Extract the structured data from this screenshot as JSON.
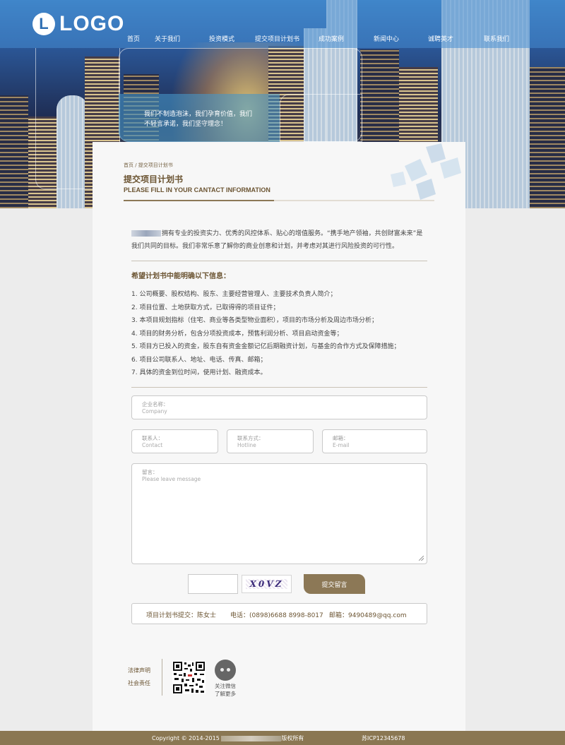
{
  "header": {
    "logo_letter": "L",
    "logo_text": "LOGO",
    "nav": [
      {
        "label": "首页"
      },
      {
        "label": "关于我们"
      },
      {
        "label": "投资模式"
      },
      {
        "label": "提交项目计划书"
      },
      {
        "label": "成功案例"
      },
      {
        "label": "新闻中心"
      },
      {
        "label": "诚聘英才"
      },
      {
        "label": "联系我们"
      }
    ]
  },
  "banner": {
    "slogan_line1": "我们不制造泡沫，我们孕育价值，我们",
    "slogan_line2": "不轻言承诺，我们坚守理念！"
  },
  "page": {
    "breadcrumb": "首页 / 提交项目计划书",
    "title": "提交项目计划书",
    "subtitle": "PLEASE FILL IN YOUR CANTACT INFORMATION",
    "intro": "拥有专业的投资实力、优秀的风控体系、贴心的增值服务。“携手地产领袖，共创财富未来”是我们共同的目标。我们非常乐意了解你的商业创意和计划，并考虑对其进行风险投资的可行性。",
    "list_title": "希望计划书中能明确以下信息：",
    "requirements": [
      "1. 公司概要、股权结构、股东、主要经营管理人、主要技术负责人简介；",
      "2. 项目位置、土地获取方式，已取得得的项目证件；",
      "3. 本项目规划指标（住宅、商业等各类型物业面积），项目的市场分析及周边市场分析；",
      "4. 项目的财务分析，包含分项投资成本，预售利润分析、项目启动资金等；",
      "5. 项目方已投入的资金，股东自有资金金额记亿后期融资计划，与基金的合作方式及保障措施；",
      "6. 项目公司联系人、地址、电话、传真、邮箱；",
      "7. 具体的资金到位时间，使用计划、融资成本。"
    ]
  },
  "form": {
    "company": {
      "label": "企业名称：",
      "placeholder": "Company"
    },
    "contact": {
      "label": "联系人：",
      "placeholder": "Contact"
    },
    "hotline": {
      "label": "联系方式：",
      "placeholder": "Hotline"
    },
    "email": {
      "label": "邮箱：",
      "placeholder": "E-mail"
    },
    "message": {
      "label": "留言：",
      "placeholder": "Please leave message"
    },
    "captcha_code": "X0VZ",
    "submit_label": "提交留言"
  },
  "contact_bar": {
    "submitter": "项目计划书提交：陈女士",
    "phone": "电话：(0898)6688 8998-8017",
    "email": "邮箱：9490489@qq.com"
  },
  "footer_links": [
    {
      "label": "法律声明"
    },
    {
      "label": "社会责任"
    }
  ],
  "wechat": {
    "line1": "关注微信",
    "line2": "了解更多"
  },
  "footer": {
    "copyright_prefix": "Copyright © 2014-2015",
    "copyright_suffix": "版权所有",
    "icp": "苏ICP12345678"
  },
  "colors": {
    "brand_brown": "#8c7856",
    "title_brown": "#6b5432",
    "nav_blue": "#468cd2"
  }
}
